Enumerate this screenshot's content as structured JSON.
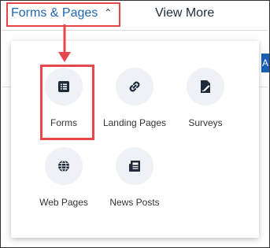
{
  "nav": {
    "forms_pages_label": "Forms & Pages",
    "view_more_label": "View More",
    "chevron": "chevron-up-icon"
  },
  "side_tab": {
    "label": "A"
  },
  "dropdown": {
    "items": [
      {
        "label": "Forms",
        "icon": "list-icon"
      },
      {
        "label": "Landing Pages",
        "icon": "link-icon"
      },
      {
        "label": "Surveys",
        "icon": "edit-survey-icon"
      },
      {
        "label": "Web Pages",
        "icon": "globe-icon"
      },
      {
        "label": "News Posts",
        "icon": "newspaper-icon"
      }
    ]
  },
  "colors": {
    "highlight": "#e5474d",
    "accent_blue": "#1f66b3",
    "dark": "#1f2b3a"
  }
}
